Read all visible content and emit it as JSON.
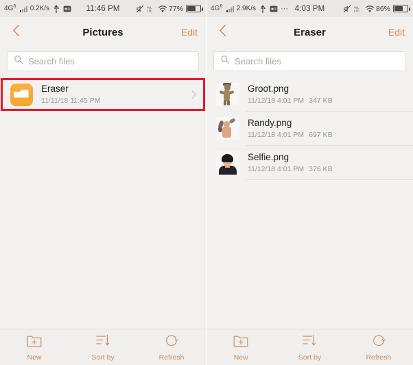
{
  "accent_color": "#cf8b5e",
  "highlight_color": "#e8182a",
  "folder_icon_color": "#f7a531",
  "panels": [
    {
      "id": "pictures",
      "status_bar": {
        "network": "4G",
        "network_sup": "R",
        "speed": "0.2K/s",
        "usb_icon": "usb-icon",
        "screenshot_icon": "screenshot-icon",
        "overflow_icon": "",
        "time": "11:46 PM",
        "mute_icon": "mute-icon",
        "volte_icon": "volte-icon",
        "wifi_icon": "wifi-icon",
        "battery_percent": "77%"
      },
      "nav": {
        "back_icon": "chevron-left-icon",
        "title": "Pictures",
        "edit_label": "Edit"
      },
      "search": {
        "icon": "search-icon",
        "placeholder": "Search files",
        "value": ""
      },
      "rows": [
        {
          "kind": "folder",
          "icon": "folder-icon",
          "name": "Eraser",
          "date": "11/11/18 11:45 PM",
          "size": "",
          "chevron": "chevron-right-icon",
          "highlighted": true
        }
      ],
      "toolbar": [
        {
          "icon": "new-folder-icon",
          "label": "New"
        },
        {
          "icon": "sort-by-icon",
          "label": "Sort by"
        },
        {
          "icon": "refresh-icon",
          "label": "Refresh"
        }
      ]
    },
    {
      "id": "eraser",
      "status_bar": {
        "network": "4G",
        "network_sup": "R",
        "speed": "2.9K/s",
        "usb_icon": "usb-icon",
        "screenshot_icon": "screenshot-icon",
        "overflow_icon": "⋯",
        "time": "4:03 PM",
        "mute_icon": "mute-icon",
        "volte_icon": "volte-icon",
        "wifi_icon": "wifi-icon",
        "battery_percent": "86%"
      },
      "nav": {
        "back_icon": "chevron-left-icon",
        "title": "Eraser",
        "edit_label": "Edit"
      },
      "search": {
        "icon": "search-icon",
        "placeholder": "Search files",
        "value": ""
      },
      "rows": [
        {
          "kind": "image",
          "icon": "groot-thumbnail",
          "name": "Groot.png",
          "date": "11/12/18 4:01 PM",
          "size": "347 KB",
          "chevron": "",
          "highlighted": false
        },
        {
          "kind": "image",
          "icon": "randy-thumbnail",
          "name": "Randy.png",
          "date": "11/12/18 4:01 PM",
          "size": "697 KB",
          "chevron": "",
          "highlighted": false
        },
        {
          "kind": "image",
          "icon": "selfie-thumbnail",
          "name": "Selfie.png",
          "date": "11/12/18 4:01 PM",
          "size": "376 KB",
          "chevron": "",
          "highlighted": false
        }
      ],
      "toolbar": [
        {
          "icon": "new-folder-icon",
          "label": "New"
        },
        {
          "icon": "sort-by-icon",
          "label": "Sort by"
        },
        {
          "icon": "refresh-icon",
          "label": "Refresh"
        }
      ]
    }
  ]
}
